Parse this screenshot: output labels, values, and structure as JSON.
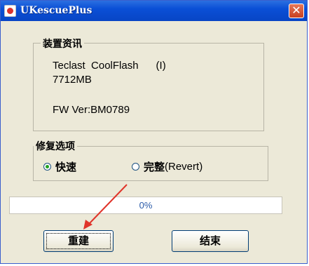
{
  "window": {
    "title": "UKescuePlus",
    "close_label": "✕"
  },
  "device_info": {
    "legend": "装置资讯",
    "name_line": "Teclast  CoolFlash      (I)",
    "size": "7712MB",
    "fw": "FW Ver:BM0789"
  },
  "repair_options": {
    "legend": "修复选项",
    "quick_label": "快速",
    "full_label": "完整",
    "full_suffix": "(Revert)",
    "selected": "quick"
  },
  "progress": {
    "text": "0%",
    "value": 0
  },
  "buttons": {
    "rebuild": "重建",
    "finish": "结束"
  },
  "annotation": {
    "arrow_color": "#e0342a"
  }
}
